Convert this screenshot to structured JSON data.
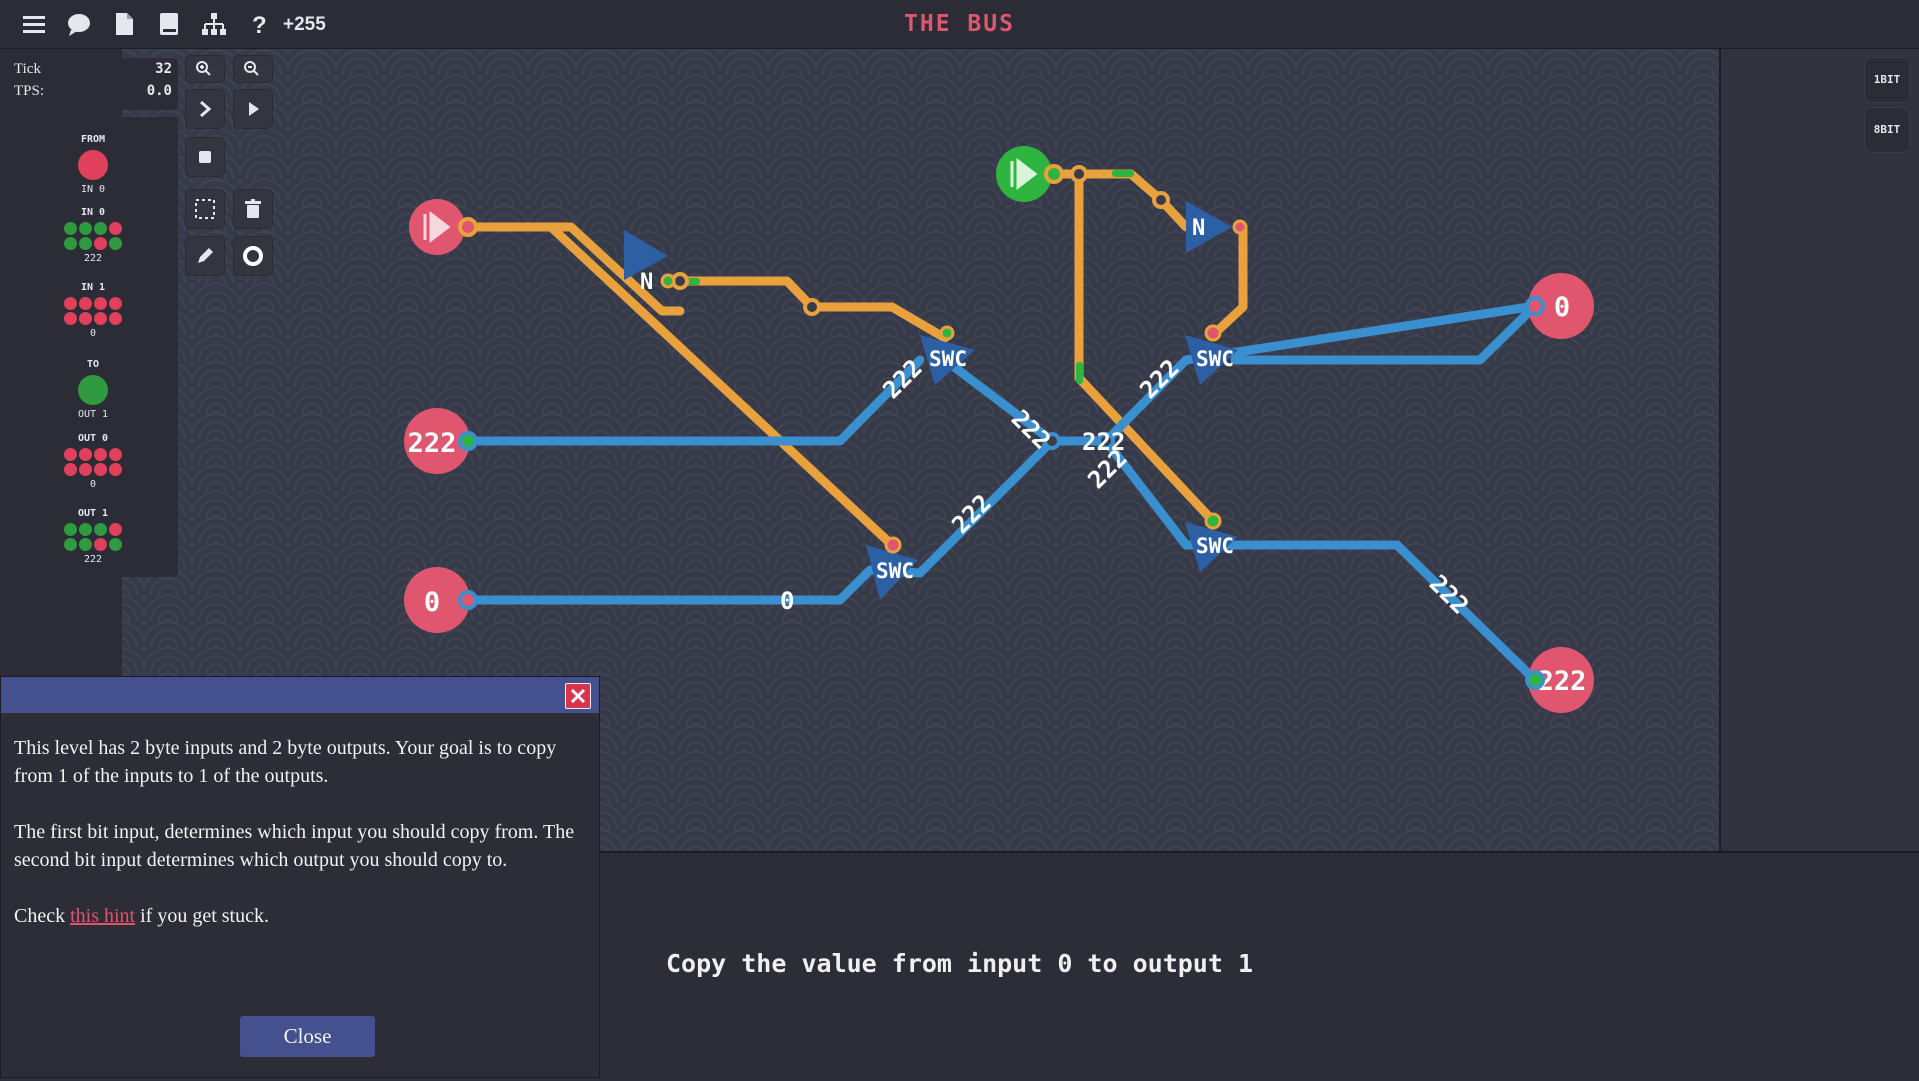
{
  "header": {
    "title": "THE BUS",
    "score": "+255",
    "icons": [
      "menu-icon",
      "chat-icon",
      "document-icon",
      "book-icon",
      "hierarchy-icon",
      "help-icon"
    ]
  },
  "sim": {
    "tick_label": "Tick",
    "tick_value": "32",
    "tps_label": "TPS:",
    "tps_value": "0.0"
  },
  "toolbar": {
    "icons": [
      "zoom-in-icon",
      "zoom-out-icon",
      "step-icon",
      "play-icon",
      "stop-icon",
      "select-icon",
      "trash-icon",
      "pencil-icon",
      "ring-icon"
    ]
  },
  "io_panel": {
    "from_label": "FROM",
    "from_sub": "IN 0",
    "in0_label": "IN 0",
    "in0_value": "222",
    "in1_label": "IN 1",
    "in1_value": "0",
    "to_label": "TO",
    "to_sub": "OUT 1",
    "out0_label": "OUT 0",
    "out0_value": "0",
    "out1_label": "OUT 1",
    "out1_value": "222",
    "colors": {
      "on": "#2f9a3f",
      "off": "#e0405b"
    }
  },
  "right_buttons": {
    "one_bit": "1BIT",
    "eight_bit": "8BIT"
  },
  "circuit": {
    "input_222": "222",
    "input_0": "0",
    "output_0": "0",
    "output_222": "222",
    "not_label": "N",
    "swc_label": "SWC",
    "wire_222": "222",
    "wire_0": "0",
    "colors": {
      "orange_wire": "#e8a13c",
      "blue_wire": "#3a8fce",
      "pin": "#e0566e",
      "green": "#2fb53f"
    }
  },
  "dialog": {
    "para1": "This level has 2 byte inputs and 2 byte outputs. Your goal is to copy from 1 of the inputs to 1 of the outputs.",
    "para2": "The first bit input, determines which input you should copy from. The second bit input determines which output you should copy to.",
    "para3_pre": "Check ",
    "para3_link": "this hint",
    "para3_post": " if you get stuck.",
    "close_label": "Close"
  },
  "instruction": "Copy the value from input 0 to output 1"
}
